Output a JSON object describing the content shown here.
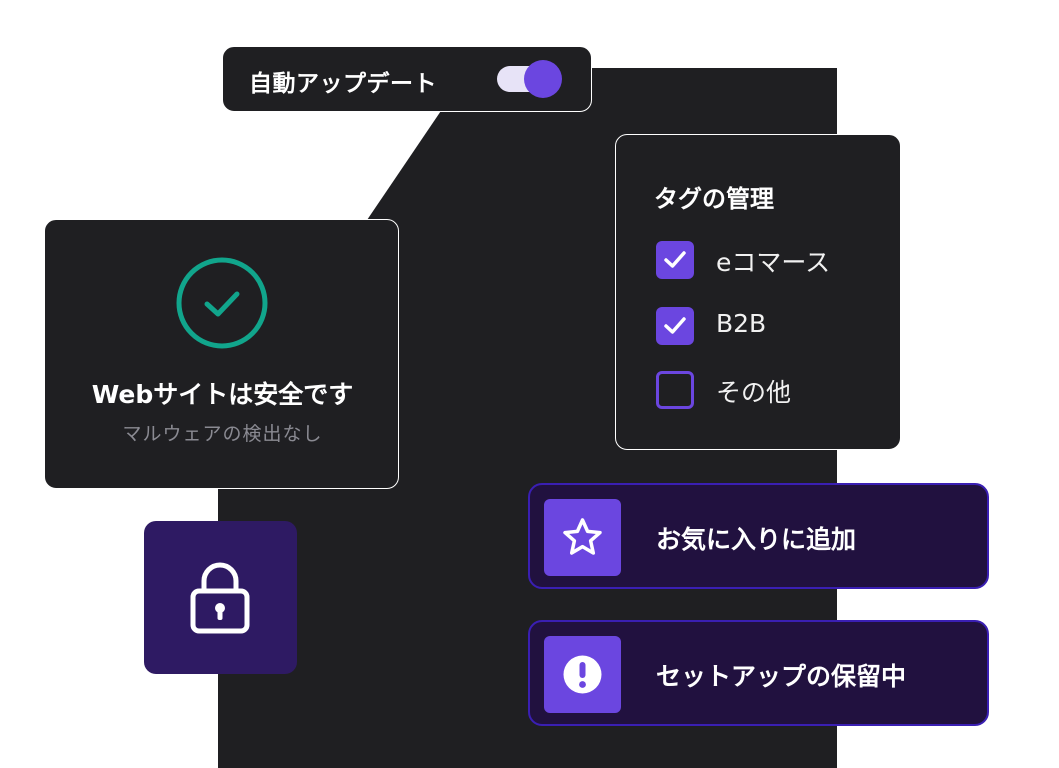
{
  "auto_update": {
    "label": "自動アップデート",
    "enabled": true
  },
  "tags": {
    "title": "タグの管理",
    "items": [
      {
        "label": "eコマース",
        "checked": true
      },
      {
        "label": "B2B",
        "checked": true
      },
      {
        "label": "その他",
        "checked": false
      }
    ]
  },
  "safety": {
    "title": "Webサイトは安全です",
    "subtitle": "マルウェアの検出なし"
  },
  "actions": {
    "favorite": {
      "label": "お気に入りに追加",
      "icon": "star-icon"
    },
    "pending": {
      "label": "セットアップの保留中",
      "icon": "exclamation-icon"
    }
  },
  "colors": {
    "accent": "#6b46e0",
    "card_bg": "#1f1f22",
    "success": "#11a58c",
    "action_bg": "#21113f",
    "lock_bg": "#2e1a63"
  }
}
